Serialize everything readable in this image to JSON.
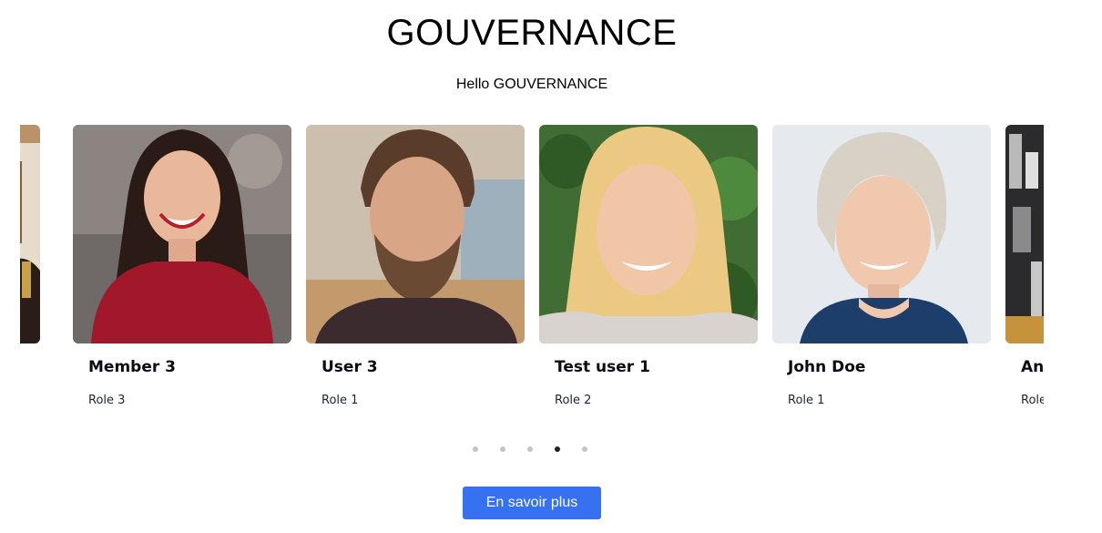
{
  "section": {
    "title": "GOUVERNANCE",
    "subtitle": "Hello GOUVERNANCE"
  },
  "carousel": {
    "members": [
      {
        "name": "Member 3",
        "role": "Role 3"
      },
      {
        "name": "User 3",
        "role": "Role 1"
      },
      {
        "name": "Test user 1",
        "role": "Role 2"
      },
      {
        "name": "John Doe",
        "role": "Role 1"
      },
      {
        "name": "An",
        "role": "Role"
      }
    ],
    "dots_count": 5,
    "active_dot": 4
  },
  "cta": {
    "label": "En savoir plus"
  },
  "colors": {
    "accent": "#3571f1",
    "dot_inactive": "#c4c4c4",
    "dot_active": "#222222"
  }
}
